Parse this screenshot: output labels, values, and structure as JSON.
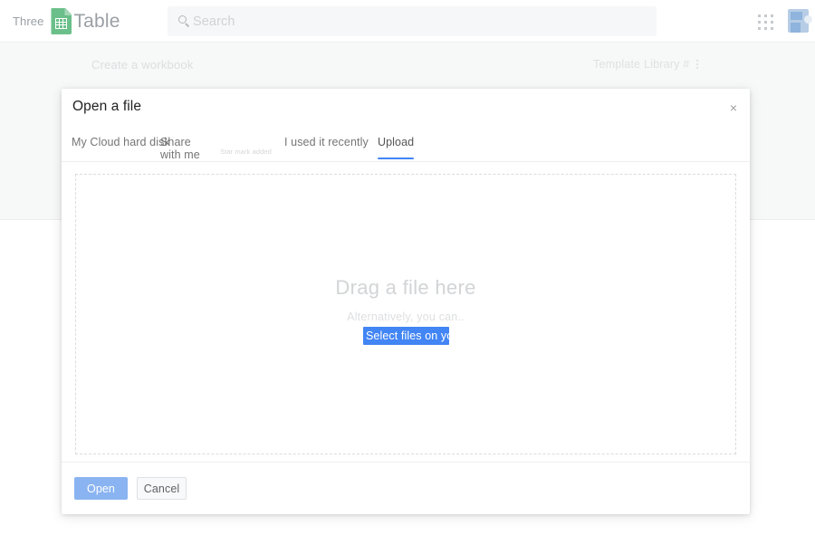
{
  "topbar": {
    "brand_prefix": "Three",
    "brand_name": "Table",
    "logo_icon": "sheets-document-icon",
    "search": {
      "placeholder": "Search",
      "value": "",
      "icon": "search-icon"
    },
    "apps_icon": "apps-grid-icon",
    "avatar_icon": "user-avatar-icon"
  },
  "page": {
    "create_workbook_label": "Create a workbook",
    "template_library_label": "Template Library #",
    "template_library_menu_icon": "vertical-dots-icon"
  },
  "dialog": {
    "title": "Open a file",
    "close_icon": "close-icon",
    "close_label": "×",
    "tabs": [
      {
        "label": "My Cloud hard disk",
        "active": false
      },
      {
        "label": "Share with me",
        "active": false
      },
      {
        "label": "Star mark added",
        "active": false,
        "faded": true
      },
      {
        "label": "I used it recently",
        "active": false
      },
      {
        "label": "Upload",
        "active": true
      }
    ],
    "dropzone": {
      "title": "Drag a file here",
      "alternative_text": "Alternatively, you can..",
      "select_button_label": "Select files on your device"
    },
    "footer": {
      "open_label": "Open",
      "cancel_label": "Cancel"
    }
  },
  "colors": {
    "accent_blue": "#4285f4",
    "open_button_blue": "#8ab4f1",
    "brand_green": "#6bbf8a",
    "band_gray": "#f7f8f8"
  }
}
